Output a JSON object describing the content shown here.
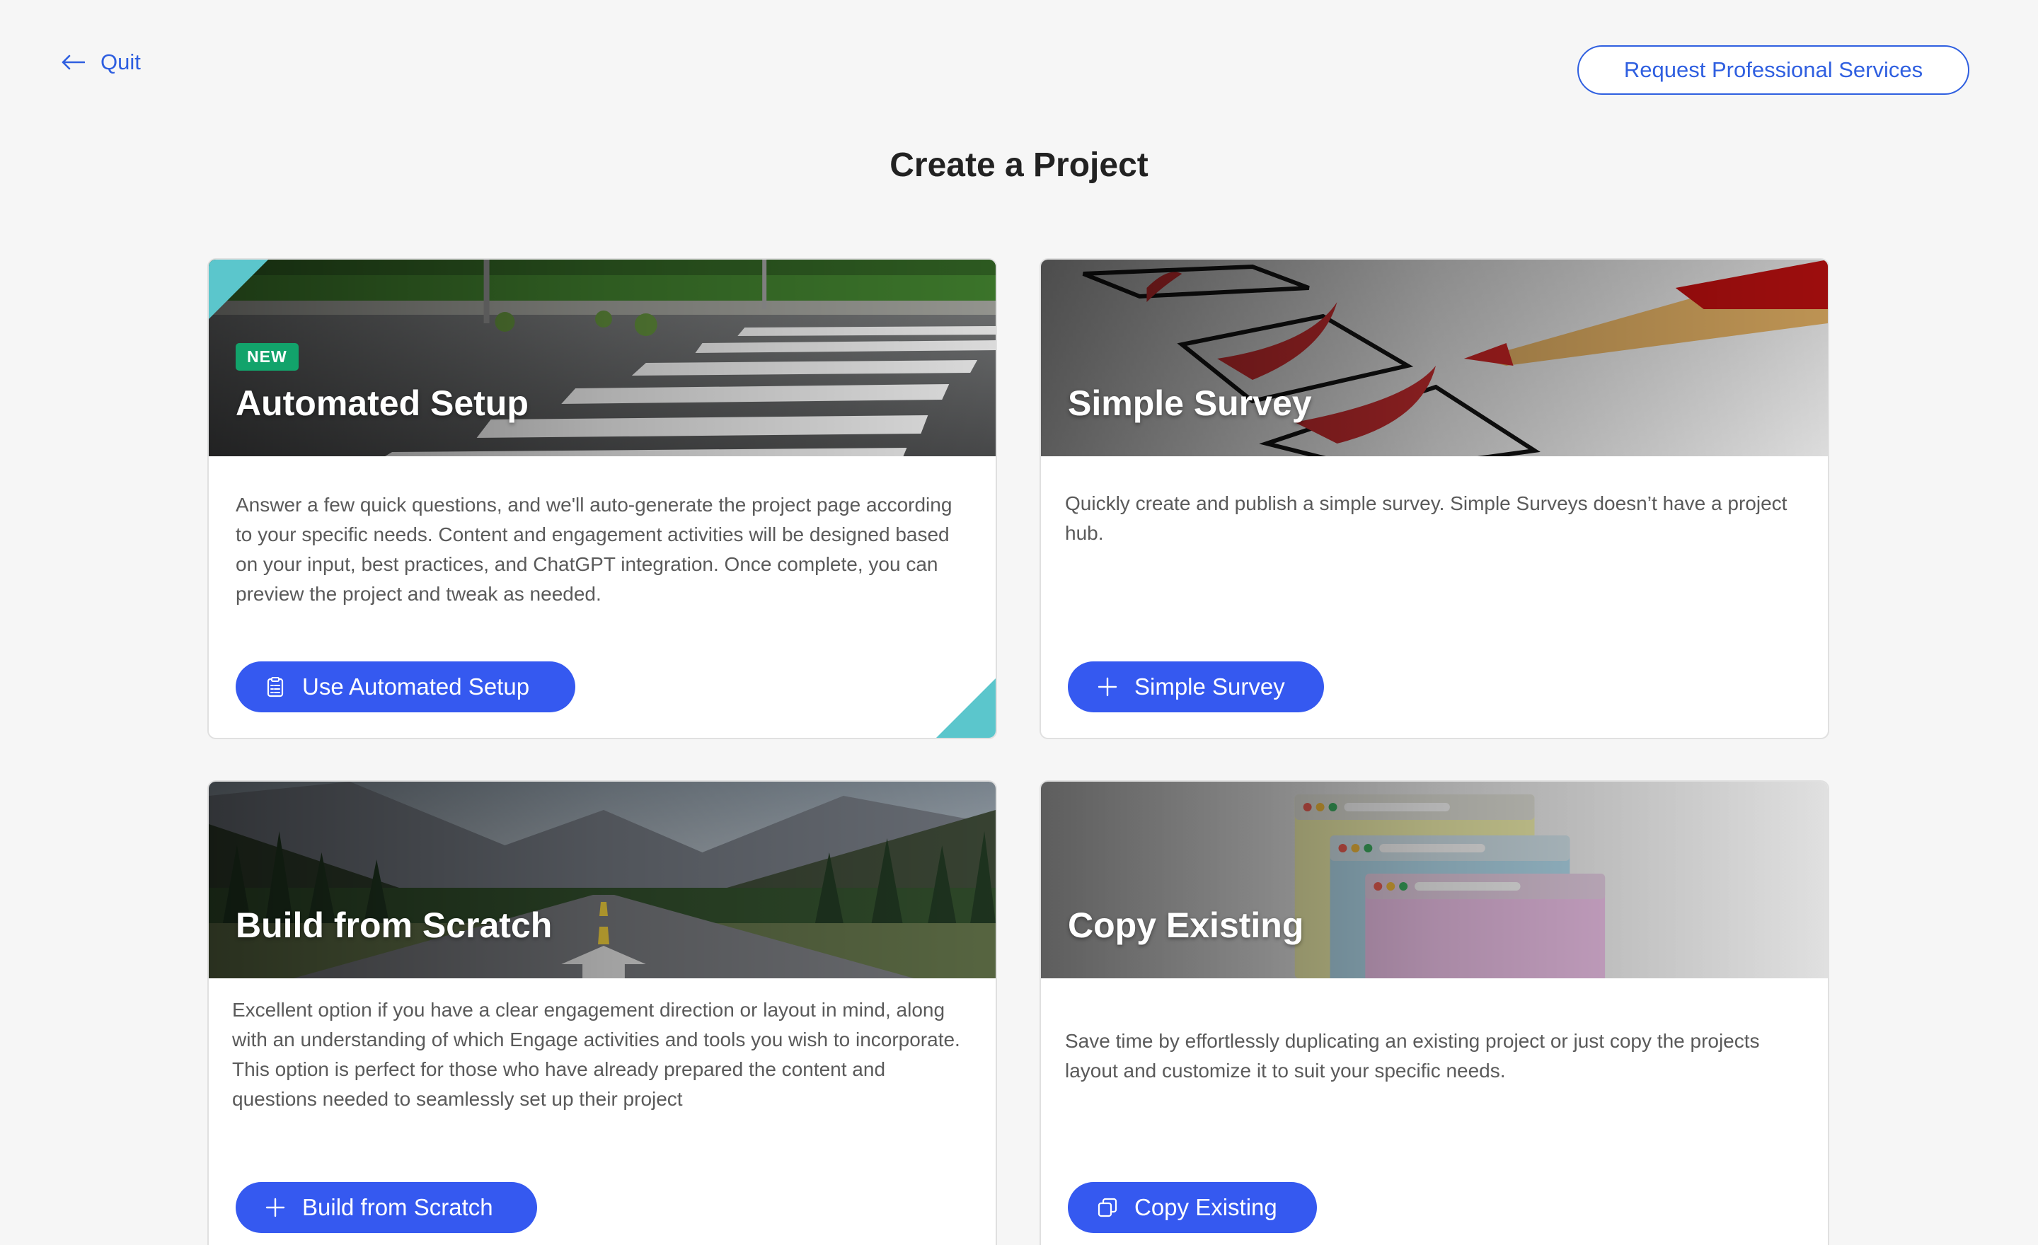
{
  "header": {
    "quit_label": "Quit",
    "request_services_label": "Request Professional Services"
  },
  "page": {
    "title": "Create a Project"
  },
  "cards": [
    {
      "title": "Automated Setup",
      "badge": "NEW",
      "description": "Answer a few quick questions, and we'll auto-generate the project page according to your specific needs. Content and engagement activities will be designed based on your input, best practices, and ChatGPT integration. Once complete, you can preview the project and tweak as needed.",
      "button_label": "Use Automated Setup",
      "button_icon": "clipboard-list-icon"
    },
    {
      "title": "Simple Survey",
      "description": "Quickly create and publish a simple survey. Simple Surveys doesn’t have a project hub.",
      "button_label": "Simple Survey",
      "button_icon": "plus-icon"
    },
    {
      "title": "Build from Scratch",
      "description": "Excellent option if you have a clear engagement direction or layout in mind, along with an understanding of which Engage activities and tools you wish to incorporate. This option is perfect for those who have already prepared the content and questions needed to seamlessly set up their project",
      "button_label": "Build from Scratch",
      "button_icon": "plus-icon"
    },
    {
      "title": "Copy Existing",
      "description": "Save time by effortlessly duplicating an existing project or just copy the projects layout and customize it to suit your specific needs.",
      "button_label": "Copy Existing",
      "button_icon": "copy-icon"
    }
  ],
  "colors": {
    "accent": "#3559f0",
    "link": "#2f5fe0",
    "badge_green": "#12a36b",
    "corner_teal": "#5bc6cc",
    "background": "#f6f6f6"
  }
}
